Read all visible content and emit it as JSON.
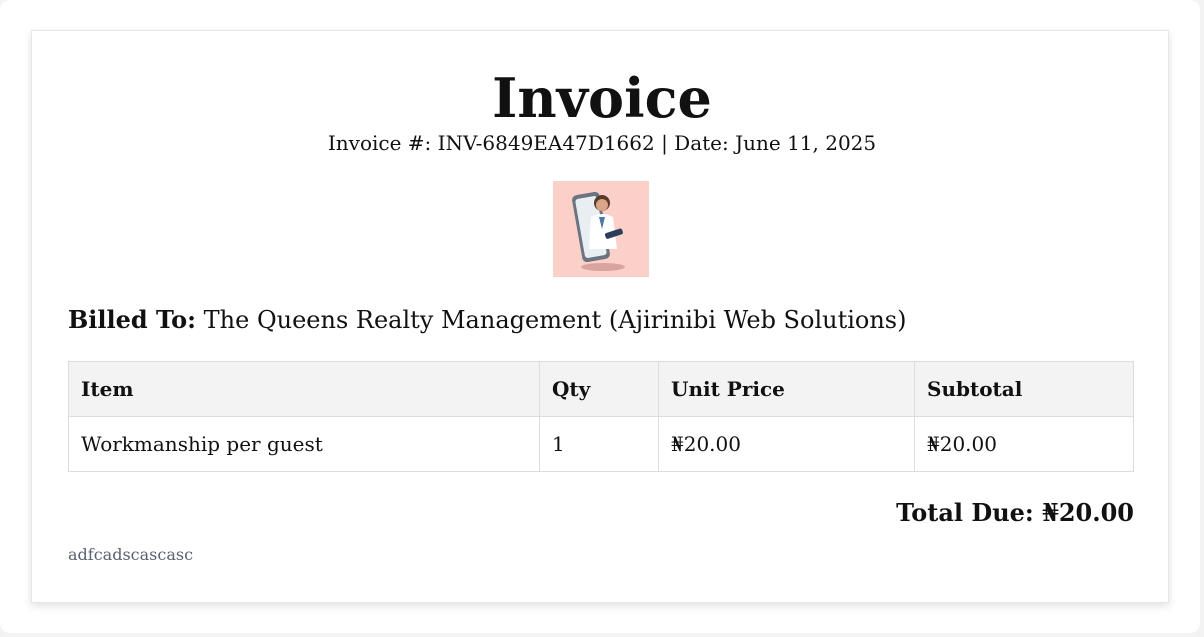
{
  "invoice": {
    "title": "Invoice",
    "meta_line": "Invoice #: INV-6849EA47D1662 | Date: June 11, 2025",
    "logo_icon": "doctor-in-phone-image",
    "billed_label": "Billed To:",
    "billed_name": "The Queens Realty Management (Ajirinibi Web Solutions)",
    "table": {
      "headers": [
        "Item",
        "Qty",
        "Unit Price",
        "Subtotal"
      ],
      "rows": [
        [
          "Workmanship per guest",
          "1",
          "₦20.00",
          "₦20.00"
        ]
      ]
    },
    "total": "Total Due: ₦20.00",
    "note": "adfcadscascasc"
  }
}
